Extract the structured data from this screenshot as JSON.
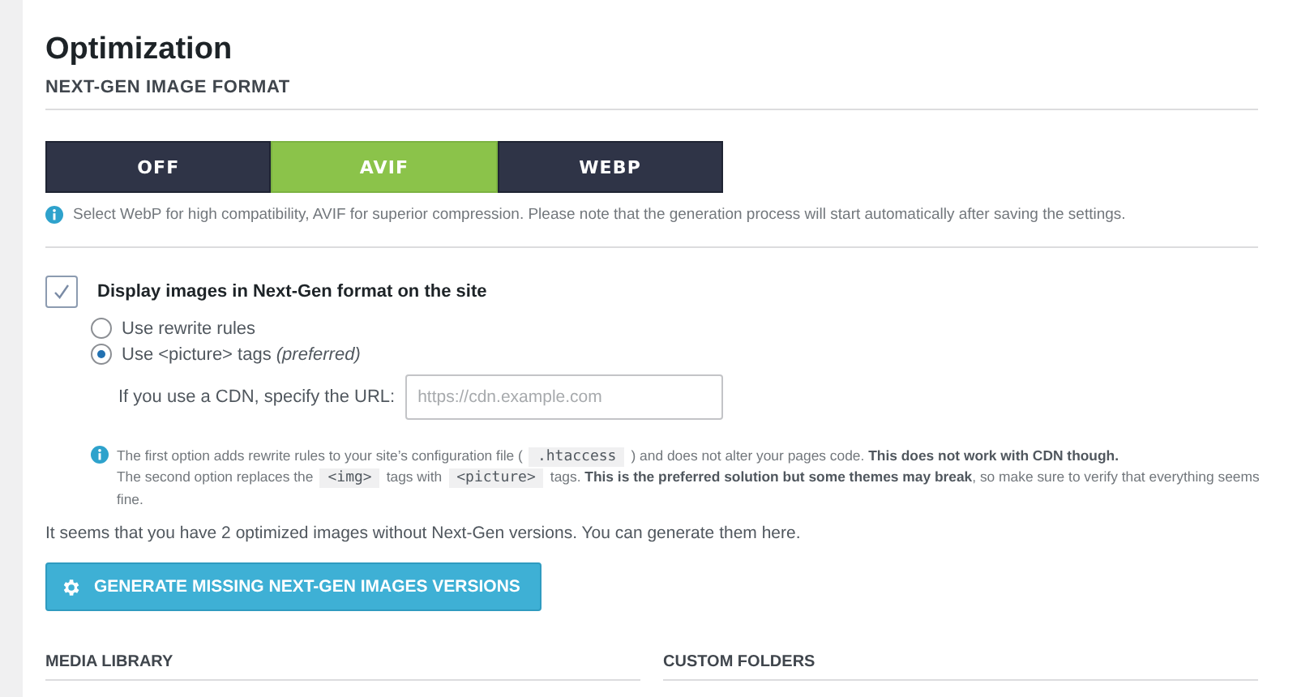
{
  "title": "Optimization",
  "section_heading": "NEXT-GEN IMAGE FORMAT",
  "format_options": [
    {
      "label": "OFF",
      "selected": false
    },
    {
      "label": "AVIF",
      "selected": true
    },
    {
      "label": "WEBP",
      "selected": false
    }
  ],
  "format_hint": "Select WebP for high compatibility, AVIF for superior compression. Please note that the generation process will start automatically after saving the settings.",
  "display_option": {
    "label": "Display images in Next-Gen format on the site",
    "checked": true
  },
  "methods": [
    {
      "label": "Use rewrite rules",
      "selected": false
    },
    {
      "label": "Use <picture> tags *(preferred)*",
      "selected": true
    }
  ],
  "cdn": {
    "label": "If you use a CDN, specify the URL:",
    "placeholder": "https://cdn.example.com"
  },
  "notes": [
    [
      {
        "kind": "text",
        "text": "The first option adds rewrite rules to your site’s configuration file ("
      },
      {
        "kind": "code",
        "text": ".htaccess"
      },
      {
        "kind": "text",
        "text": ") and does not alter your pages code. **This does not work with CDN though.**"
      }
    ],
    [
      {
        "kind": "text",
        "text": "The second option replaces the"
      },
      {
        "kind": "code",
        "text": "<img>"
      },
      {
        "kind": "text",
        "text": "tags with"
      },
      {
        "kind": "code",
        "text": "<picture>"
      },
      {
        "kind": "text",
        "text": "tags. **This is the preferred solution but some themes may break**, so make sure to verify that everything seems"
      }
    ],
    [
      {
        "kind": "text",
        "text": "fine."
      }
    ]
  ],
  "status_text": "It seems that you have 2 optimized images without Next-Gen versions. You can generate them here.",
  "generate_button": "GENERATE MISSING NEXT-GEN IMAGES VERSIONS",
  "bottom_headings": [
    "MEDIA LIBRARY",
    "CUSTOM FOLDERS"
  ]
}
